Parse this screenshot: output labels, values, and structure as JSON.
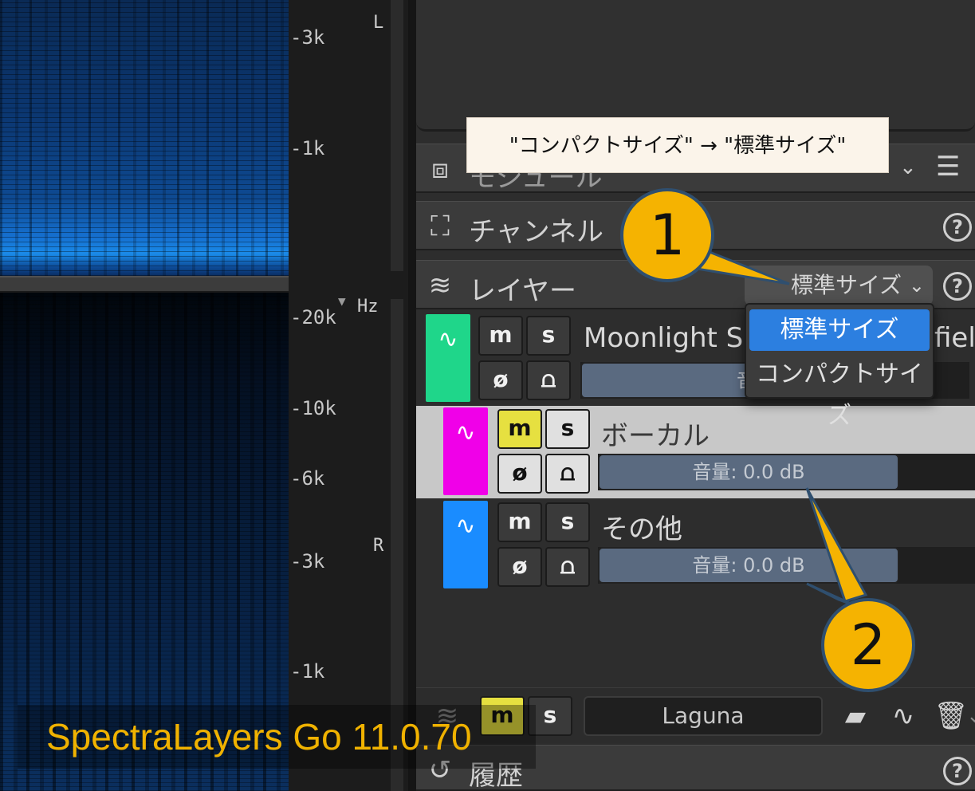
{
  "spectrogram": {
    "top_ticks": [
      "-3k",
      "-1k"
    ],
    "bottom_ticks": [
      "-20k",
      "-10k",
      "-6k",
      "-3k",
      "-1k"
    ],
    "unit": "Hz",
    "channel_left": "L",
    "channel_right": "R"
  },
  "panels": {
    "module": {
      "title": "モジュール"
    },
    "channel": {
      "title": "チャンネル",
      "help": "?"
    },
    "layer": {
      "title": "レイヤー",
      "help": "?",
      "size_select_value": "標準サイズ"
    },
    "history": {
      "title": "履歴",
      "help": "?"
    }
  },
  "dropdown": {
    "options": [
      {
        "label": "標準サイズ",
        "selected": true
      },
      {
        "label": "コンパクトサイズ",
        "selected": false
      }
    ]
  },
  "layers": [
    {
      "name": "Moonlight Sh",
      "name_tail": "fiel",
      "volume": "音量",
      "color": "#1fd68a",
      "m": "m",
      "s": "s",
      "mute_active": false
    },
    {
      "name": "ボーカル",
      "volume": "音量: 0.0 dB",
      "color": "#f000e8",
      "m": "m",
      "s": "s",
      "mute_active": true
    },
    {
      "name": "その他",
      "volume": "音量: 0.0 dB",
      "color": "#1a8cff",
      "m": "m",
      "s": "s",
      "mute_active": false
    }
  ],
  "bottom_bar": {
    "m": "m",
    "s": "s",
    "preset": "Laguna"
  },
  "annotations": {
    "tooltip": "\"コンパクトサイズ\" → \"標準サイズ\"",
    "callout_1": "1",
    "callout_2": "2",
    "version": "SpectraLayers Go 11.0.70"
  },
  "icons": [
    "module-icon",
    "channel-icon",
    "layer-stack-icon",
    "waveform-icon",
    "phase-icon",
    "envelope-icon",
    "chevron-down-icon",
    "list-icon",
    "help-icon",
    "folder-add-icon",
    "wave-add-icon",
    "trash-icon",
    "history-icon"
  ],
  "colors": {
    "accent_blue": "#2c7fe0",
    "mute_on": "#e6e040",
    "callout": "#f5b301",
    "version_text": "#f0b200"
  }
}
